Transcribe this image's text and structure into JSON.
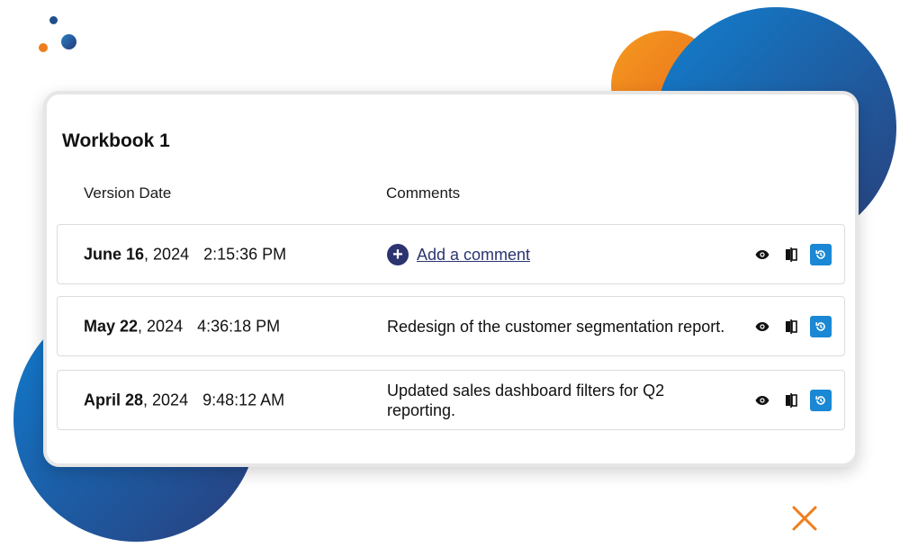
{
  "workbook": {
    "title": "Workbook 1"
  },
  "columns": {
    "date": "Version Date",
    "comments": "Comments"
  },
  "rows": [
    {
      "day": "June 16",
      "year": ", 2024",
      "time": "2:15:36 PM",
      "comment": "",
      "add_comment_label": "Add a comment"
    },
    {
      "day": "May 22",
      "year": ", 2024",
      "time": "4:36:18 PM",
      "comment": "Redesign of the customer segmentation report."
    },
    {
      "day": "April 28",
      "year": ", 2024",
      "time": "9:48:12 AM",
      "comment": "Updated sales dashboard filters for Q2 reporting."
    }
  ],
  "icons": {
    "view": "eye-icon",
    "compare": "compare-icon",
    "restore": "restore-icon",
    "add": "plus-circle-icon"
  },
  "colors": {
    "accent": "#1a88d4",
    "navy": "#2c3470",
    "orange": "#f07d1c"
  }
}
